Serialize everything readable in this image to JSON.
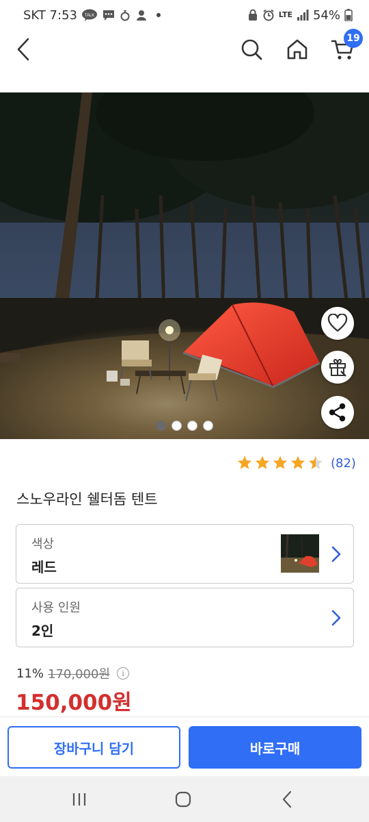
{
  "status_bar": {
    "carrier_time": "SKT 7:53",
    "network": "LTE",
    "battery": "54%"
  },
  "header": {
    "cart_count": "19"
  },
  "gallery": {
    "page_count": 4,
    "active_index": 0
  },
  "rating": {
    "stars": 4.5,
    "count": "(82)"
  },
  "product": {
    "title": "스노우라인 쉘터돔 텐트"
  },
  "options": {
    "color_label": "색상",
    "color_value": "레드",
    "people_label": "사용 인원",
    "people_value": "2인"
  },
  "price": {
    "discount": "11%",
    "original": "170,000원",
    "sale": "150,000원"
  },
  "actions": {
    "add_to_cart": "장바구니 담기",
    "buy_now": "바로구매"
  },
  "colors": {
    "accent": "#2f6ef5",
    "sale": "#d32f2f",
    "star": "#f5a623"
  }
}
